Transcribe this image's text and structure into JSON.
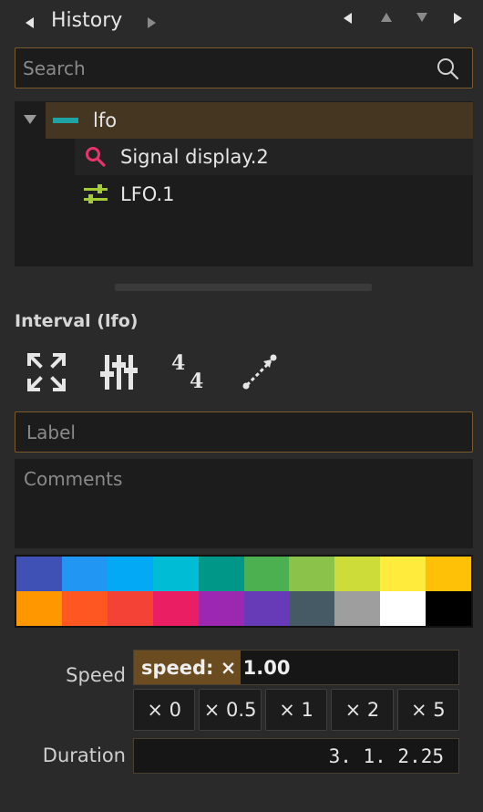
{
  "header": {
    "title": "History"
  },
  "search": {
    "placeholder": "Search"
  },
  "tree": {
    "items": [
      {
        "label": "lfo",
        "icon": "process-bar-icon",
        "color": "#1fa3a3"
      },
      {
        "label": "Signal display.2",
        "icon": "magnifier-icon",
        "color": "#e8336b"
      },
      {
        "label": "LFO.1",
        "icon": "sliders-icon",
        "color": "#a4cc38"
      }
    ]
  },
  "inspector": {
    "section_title": "Interval (lfo)",
    "tools": [
      "expand-icon",
      "mixer-sliders-icon",
      "time-signature-icon",
      "connect-dots-icon"
    ],
    "time_signature": {
      "top": "4",
      "bottom": "4"
    },
    "label_placeholder": "Label",
    "comments_placeholder": "Comments"
  },
  "palette": {
    "colors": [
      "#3f51b5",
      "#2196f3",
      "#03a9f4",
      "#00bcd4",
      "#009688",
      "#4caf50",
      "#8bc34a",
      "#cddc39",
      "#ffeb3b",
      "#ffc107",
      "#ff9800",
      "#ff5722",
      "#f44336",
      "#e91e63",
      "#9c27b0",
      "#673ab7",
      "#455a64",
      "#9e9e9e",
      "#ffffff",
      "#000000"
    ]
  },
  "speed": {
    "label": "Speed",
    "slider_text": "speed: × 1.00",
    "fill_fraction": 0.33,
    "multipliers": [
      "× 0",
      "× 0.5",
      "× 1",
      "× 2",
      "× 5"
    ]
  },
  "duration": {
    "label": "Duration",
    "value": "3. 1. 2.25"
  },
  "colors": {
    "accent_border": "#7a5a2a",
    "selection": "#453621"
  }
}
